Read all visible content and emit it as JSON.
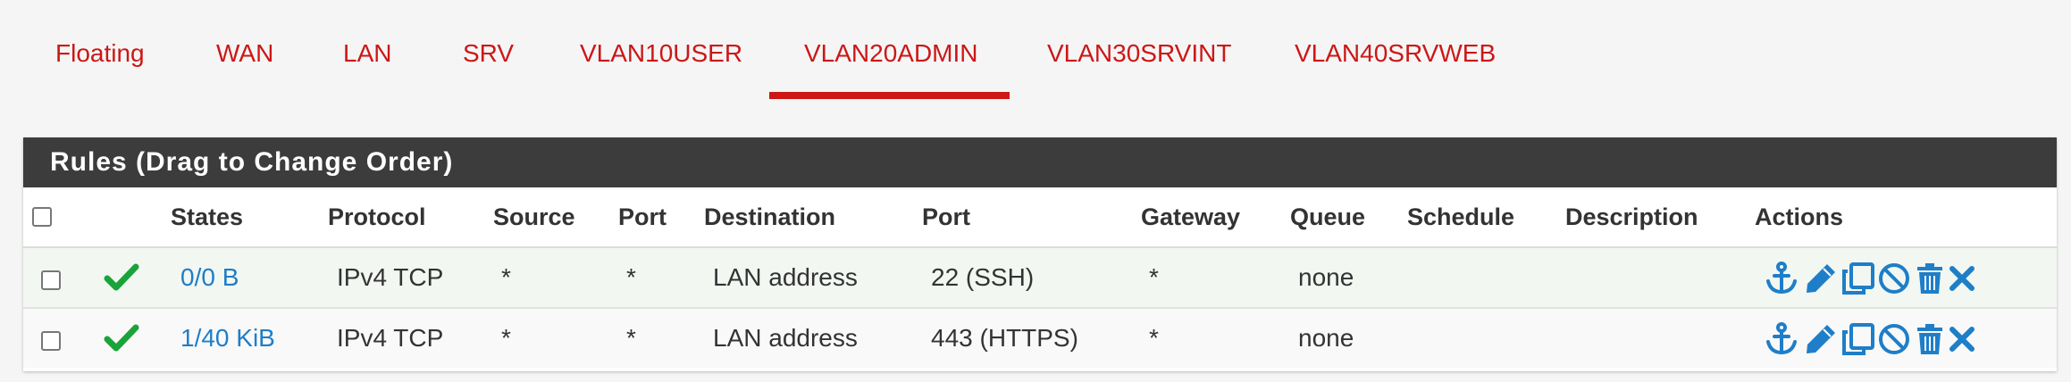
{
  "tabs": [
    {
      "label": "Floating"
    },
    {
      "label": "WAN"
    },
    {
      "label": "LAN"
    },
    {
      "label": "SRV"
    },
    {
      "label": "VLAN10USER"
    },
    {
      "label": "VLAN20ADMIN",
      "active": true
    },
    {
      "label": "VLAN30SRVINT"
    },
    {
      "label": "VLAN40SRVWEB"
    }
  ],
  "panel": {
    "title": "Rules (Drag to Change Order)"
  },
  "columns": {
    "states": "States",
    "protocol": "Protocol",
    "source": "Source",
    "port": "Port",
    "destination": "Destination",
    "dest_port": "Port",
    "gateway": "Gateway",
    "queue": "Queue",
    "schedule": "Schedule",
    "description": "Description",
    "actions": "Actions"
  },
  "rows": [
    {
      "status_icon": "check-icon",
      "states": "0/0 B",
      "protocol": "IPv4 TCP",
      "source": "*",
      "port": "*",
      "destination": "LAN address",
      "dest_port": "22 (SSH)",
      "gateway": "*",
      "queue": "none",
      "schedule": "",
      "description": ""
    },
    {
      "status_icon": "check-icon",
      "states": "1/40 KiB",
      "protocol": "IPv4 TCP",
      "source": "*",
      "port": "*",
      "destination": "LAN address",
      "dest_port": "443 (HTTPS)",
      "gateway": "*",
      "queue": "none",
      "schedule": "",
      "description": ""
    }
  ],
  "action_icons": [
    "anchor-icon",
    "pencil-icon",
    "copy-icon",
    "disable-icon",
    "trash-icon",
    "delete-x-icon"
  ],
  "colors": {
    "tab_accent": "#cc1717",
    "panel_header": "#3c3c3c",
    "link": "#1e7ec8",
    "enabled_check": "#1aa33a",
    "action_icon": "#1e7ec8"
  }
}
